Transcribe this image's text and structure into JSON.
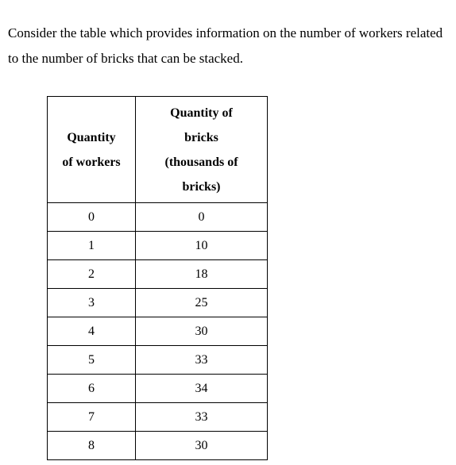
{
  "intro": {
    "text": "Consider the table which provides information on the number of workers related to the number of bricks that can be stacked."
  },
  "table": {
    "headers": [
      {
        "id": "workers",
        "lines": [
          "Quantity",
          "of workers"
        ],
        "full_text": "Quantity of workers"
      },
      {
        "id": "bricks",
        "lines": [
          "Quantity of",
          "bricks",
          "(thousands of",
          "bricks)"
        ],
        "full_text": "Quantity of bricks (thousands of bricks)"
      }
    ],
    "rows": [
      {
        "workers": "0",
        "bricks": "0"
      },
      {
        "workers": "1",
        "bricks": "10"
      },
      {
        "workers": "2",
        "bricks": "18"
      },
      {
        "workers": "3",
        "bricks": "25"
      },
      {
        "workers": "4",
        "bricks": "30"
      },
      {
        "workers": "5",
        "bricks": "33"
      },
      {
        "workers": "6",
        "bricks": "34"
      },
      {
        "workers": "7",
        "bricks": "33"
      },
      {
        "workers": "8",
        "bricks": "30"
      }
    ]
  },
  "chart_data": {
    "type": "table",
    "title": "Quantity of workers vs Quantity of bricks",
    "columns": [
      "Quantity of workers",
      "Quantity of bricks (thousands of bricks)"
    ],
    "xlabel": "Quantity of workers",
    "ylabel": "Quantity of bricks (thousands of bricks)",
    "x": [
      0,
      1,
      2,
      3,
      4,
      5,
      6,
      7,
      8
    ],
    "values": [
      0,
      10,
      18,
      25,
      30,
      33,
      34,
      33,
      30
    ],
    "series": [
      {
        "name": "Quantity of bricks (thousands of bricks)",
        "values": [
          0,
          10,
          18,
          25,
          30,
          33,
          34,
          33,
          30
        ]
      }
    ],
    "grid": false,
    "legend": "none"
  },
  "colors": {
    "background": "#ffffff",
    "text": "#000000",
    "border": "#000000"
  }
}
